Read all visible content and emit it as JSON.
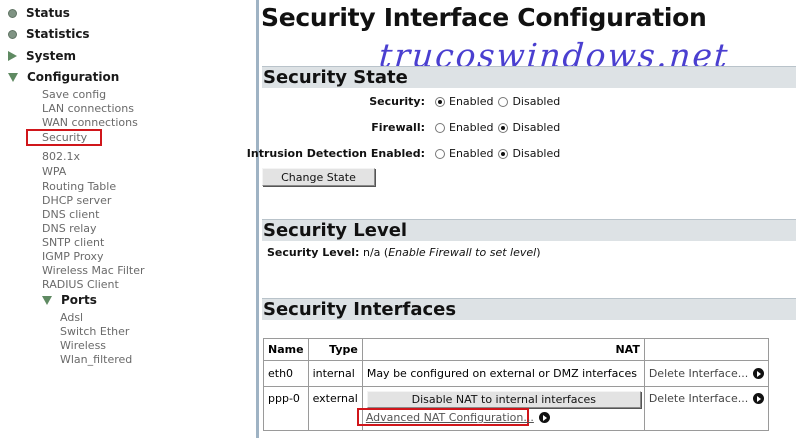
{
  "sidebar": {
    "top_items": [
      {
        "label": "Status",
        "icon": "bullet-icon"
      },
      {
        "label": "Statistics",
        "icon": "bullet-icon"
      },
      {
        "label": "System",
        "icon": "expand-arrow-icon"
      },
      {
        "label": "Configuration",
        "icon": "collapse-arrow-icon"
      }
    ],
    "config_items": [
      "Save config",
      "LAN connections",
      "WAN connections",
      "Security",
      "802.1x",
      "WPA",
      "Routing Table",
      "DHCP server",
      "DNS client",
      "DNS relay",
      "SNTP client",
      "IGMP Proxy",
      "Wireless Mac Filter",
      "RADIUS Client"
    ],
    "ports": {
      "label": "Ports",
      "items": [
        "Adsl",
        "Switch Ether",
        "Wireless",
        "Wlan_filtered"
      ]
    },
    "highlighted_item": "Security",
    "highlight_color": "#d0161b"
  },
  "main": {
    "title": "Security Interface Configuration",
    "watermark": "trucoswindows.net",
    "security_state": {
      "heading": "Security State",
      "rows": [
        {
          "label": "Security:",
          "options": [
            "Enabled",
            "Disabled"
          ],
          "selected": "Enabled"
        },
        {
          "label": "Firewall:",
          "options": [
            "Enabled",
            "Disabled"
          ],
          "selected": "Disabled"
        },
        {
          "label": "Intrusion Detection Enabled:",
          "options": [
            "Enabled",
            "Disabled"
          ],
          "selected": "Disabled"
        }
      ],
      "button": "Change State"
    },
    "security_level": {
      "heading": "Security Level",
      "label": "Security Level:",
      "value": "n/a",
      "note": "Enable Firewall to set level"
    },
    "security_interfaces": {
      "heading": "Security Interfaces",
      "columns": [
        "Name",
        "Type",
        "NAT",
        ""
      ],
      "rows": [
        {
          "name": "eth0",
          "type": "internal",
          "nat": "May be configured on external or DMZ interfaces",
          "action": "Delete Interface..."
        },
        {
          "name": "ppp-0",
          "type": "external",
          "nat_button": "Disable NAT to internal interfaces",
          "nat_link": "Advanced NAT Configuration...",
          "action": "Delete Interface..."
        }
      ]
    }
  },
  "colors": {
    "section_bar": "#dde2e5",
    "watermark": "#4a3fd0",
    "highlight_box": "#d0161b"
  }
}
